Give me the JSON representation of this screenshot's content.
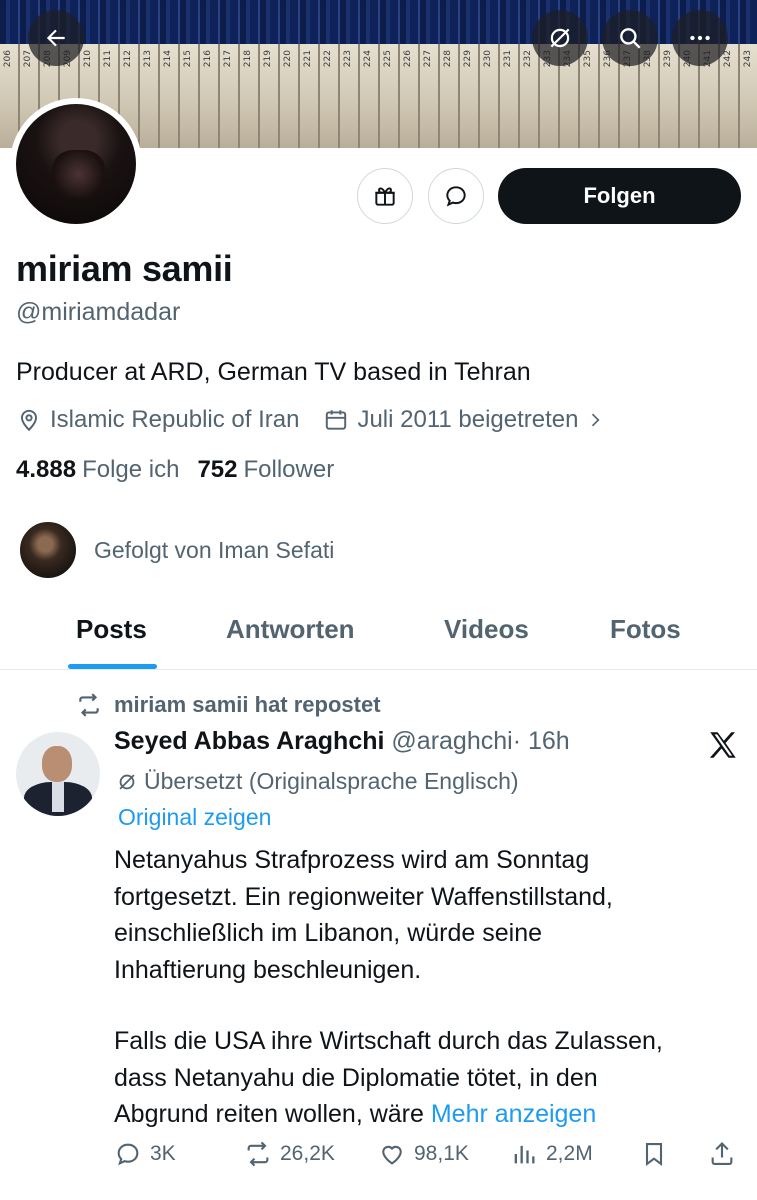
{
  "banner": {
    "spine_numbers": [
      "206",
      "207",
      "208",
      "209",
      "210",
      "211",
      "212",
      "213",
      "214",
      "215",
      "216",
      "217",
      "218",
      "219",
      "220",
      "221",
      "222",
      "223",
      "224",
      "225",
      "226",
      "227",
      "228",
      "229",
      "230",
      "231",
      "232",
      "233",
      "234",
      "235",
      "236",
      "237",
      "238",
      "239",
      "240",
      "241",
      "242",
      "243"
    ]
  },
  "profile": {
    "name": "miriam samii",
    "handle": "@miriamdadar",
    "bio": "Producer at ARD, German TV based in Tehran",
    "location": "Islamic Republic of Iran",
    "joined": "Juli 2011 beigetreten",
    "following_count": "4.888",
    "following_label": "Folge ich",
    "followers_count": "752",
    "followers_label": "Follower",
    "followed_by": "Gefolgt von Iman Sefati",
    "follow_button": "Folgen"
  },
  "tabs": [
    {
      "label": "Posts",
      "active": true
    },
    {
      "label": "Antworten",
      "active": false
    },
    {
      "label": "Videos",
      "active": false
    },
    {
      "label": "Fotos",
      "active": false
    }
  ],
  "post": {
    "repost_label": "miriam samii hat repostet",
    "author_name": "Seyed Abbas Araghchi",
    "author_handle": "@araghchi",
    "time": "· 16h",
    "translated_label": "Übersetzt (Originalsprache Englisch)",
    "show_original": "Original zeigen",
    "paragraph1_lines": [
      "Netanyahus Strafprozess wird am Sonntag",
      "fortgesetzt. Ein regionweiter Waffenstillstand,",
      "einschließlich im Libanon, würde seine",
      "Inhaftierung beschleunigen."
    ],
    "paragraph2_lines": [
      "Falls die USA ihre Wirtschaft durch das Zulassen,",
      "dass Netanyahu die Diplomatie tötet, in den",
      "Abgrund reiten wollen, wäre"
    ],
    "show_more": "Mehr anzeigen",
    "replies": "3K",
    "reposts": "26,2K",
    "likes": "98,1K",
    "views": "2,2M"
  },
  "colors": {
    "accent": "#1d9bf0",
    "text": "#0f1419",
    "secondary": "#536471",
    "button_dark": "#0f1419"
  }
}
